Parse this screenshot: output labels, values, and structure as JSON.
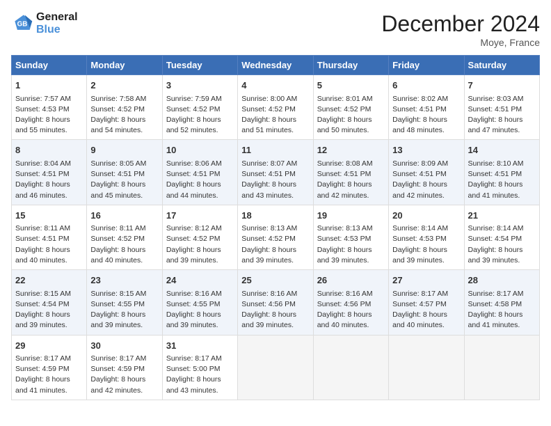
{
  "header": {
    "logo_line1": "General",
    "logo_line2": "Blue",
    "month": "December 2024",
    "location": "Moye, France"
  },
  "weekdays": [
    "Sunday",
    "Monday",
    "Tuesday",
    "Wednesday",
    "Thursday",
    "Friday",
    "Saturday"
  ],
  "weeks": [
    [
      {
        "day": "1",
        "info": "Sunrise: 7:57 AM\nSunset: 4:53 PM\nDaylight: 8 hours\nand 55 minutes."
      },
      {
        "day": "2",
        "info": "Sunrise: 7:58 AM\nSunset: 4:52 PM\nDaylight: 8 hours\nand 54 minutes."
      },
      {
        "day": "3",
        "info": "Sunrise: 7:59 AM\nSunset: 4:52 PM\nDaylight: 8 hours\nand 52 minutes."
      },
      {
        "day": "4",
        "info": "Sunrise: 8:00 AM\nSunset: 4:52 PM\nDaylight: 8 hours\nand 51 minutes."
      },
      {
        "day": "5",
        "info": "Sunrise: 8:01 AM\nSunset: 4:52 PM\nDaylight: 8 hours\nand 50 minutes."
      },
      {
        "day": "6",
        "info": "Sunrise: 8:02 AM\nSunset: 4:51 PM\nDaylight: 8 hours\nand 48 minutes."
      },
      {
        "day": "7",
        "info": "Sunrise: 8:03 AM\nSunset: 4:51 PM\nDaylight: 8 hours\nand 47 minutes."
      }
    ],
    [
      {
        "day": "8",
        "info": "Sunrise: 8:04 AM\nSunset: 4:51 PM\nDaylight: 8 hours\nand 46 minutes."
      },
      {
        "day": "9",
        "info": "Sunrise: 8:05 AM\nSunset: 4:51 PM\nDaylight: 8 hours\nand 45 minutes."
      },
      {
        "day": "10",
        "info": "Sunrise: 8:06 AM\nSunset: 4:51 PM\nDaylight: 8 hours\nand 44 minutes."
      },
      {
        "day": "11",
        "info": "Sunrise: 8:07 AM\nSunset: 4:51 PM\nDaylight: 8 hours\nand 43 minutes."
      },
      {
        "day": "12",
        "info": "Sunrise: 8:08 AM\nSunset: 4:51 PM\nDaylight: 8 hours\nand 42 minutes."
      },
      {
        "day": "13",
        "info": "Sunrise: 8:09 AM\nSunset: 4:51 PM\nDaylight: 8 hours\nand 42 minutes."
      },
      {
        "day": "14",
        "info": "Sunrise: 8:10 AM\nSunset: 4:51 PM\nDaylight: 8 hours\nand 41 minutes."
      }
    ],
    [
      {
        "day": "15",
        "info": "Sunrise: 8:11 AM\nSunset: 4:51 PM\nDaylight: 8 hours\nand 40 minutes."
      },
      {
        "day": "16",
        "info": "Sunrise: 8:11 AM\nSunset: 4:52 PM\nDaylight: 8 hours\nand 40 minutes."
      },
      {
        "day": "17",
        "info": "Sunrise: 8:12 AM\nSunset: 4:52 PM\nDaylight: 8 hours\nand 39 minutes."
      },
      {
        "day": "18",
        "info": "Sunrise: 8:13 AM\nSunset: 4:52 PM\nDaylight: 8 hours\nand 39 minutes."
      },
      {
        "day": "19",
        "info": "Sunrise: 8:13 AM\nSunset: 4:53 PM\nDaylight: 8 hours\nand 39 minutes."
      },
      {
        "day": "20",
        "info": "Sunrise: 8:14 AM\nSunset: 4:53 PM\nDaylight: 8 hours\nand 39 minutes."
      },
      {
        "day": "21",
        "info": "Sunrise: 8:14 AM\nSunset: 4:54 PM\nDaylight: 8 hours\nand 39 minutes."
      }
    ],
    [
      {
        "day": "22",
        "info": "Sunrise: 8:15 AM\nSunset: 4:54 PM\nDaylight: 8 hours\nand 39 minutes."
      },
      {
        "day": "23",
        "info": "Sunrise: 8:15 AM\nSunset: 4:55 PM\nDaylight: 8 hours\nand 39 minutes."
      },
      {
        "day": "24",
        "info": "Sunrise: 8:16 AM\nSunset: 4:55 PM\nDaylight: 8 hours\nand 39 minutes."
      },
      {
        "day": "25",
        "info": "Sunrise: 8:16 AM\nSunset: 4:56 PM\nDaylight: 8 hours\nand 39 minutes."
      },
      {
        "day": "26",
        "info": "Sunrise: 8:16 AM\nSunset: 4:56 PM\nDaylight: 8 hours\nand 40 minutes."
      },
      {
        "day": "27",
        "info": "Sunrise: 8:17 AM\nSunset: 4:57 PM\nDaylight: 8 hours\nand 40 minutes."
      },
      {
        "day": "28",
        "info": "Sunrise: 8:17 AM\nSunset: 4:58 PM\nDaylight: 8 hours\nand 41 minutes."
      }
    ],
    [
      {
        "day": "29",
        "info": "Sunrise: 8:17 AM\nSunset: 4:59 PM\nDaylight: 8 hours\nand 41 minutes."
      },
      {
        "day": "30",
        "info": "Sunrise: 8:17 AM\nSunset: 4:59 PM\nDaylight: 8 hours\nand 42 minutes."
      },
      {
        "day": "31",
        "info": "Sunrise: 8:17 AM\nSunset: 5:00 PM\nDaylight: 8 hours\nand 43 minutes."
      },
      {
        "day": "",
        "info": ""
      },
      {
        "day": "",
        "info": ""
      },
      {
        "day": "",
        "info": ""
      },
      {
        "day": "",
        "info": ""
      }
    ]
  ]
}
